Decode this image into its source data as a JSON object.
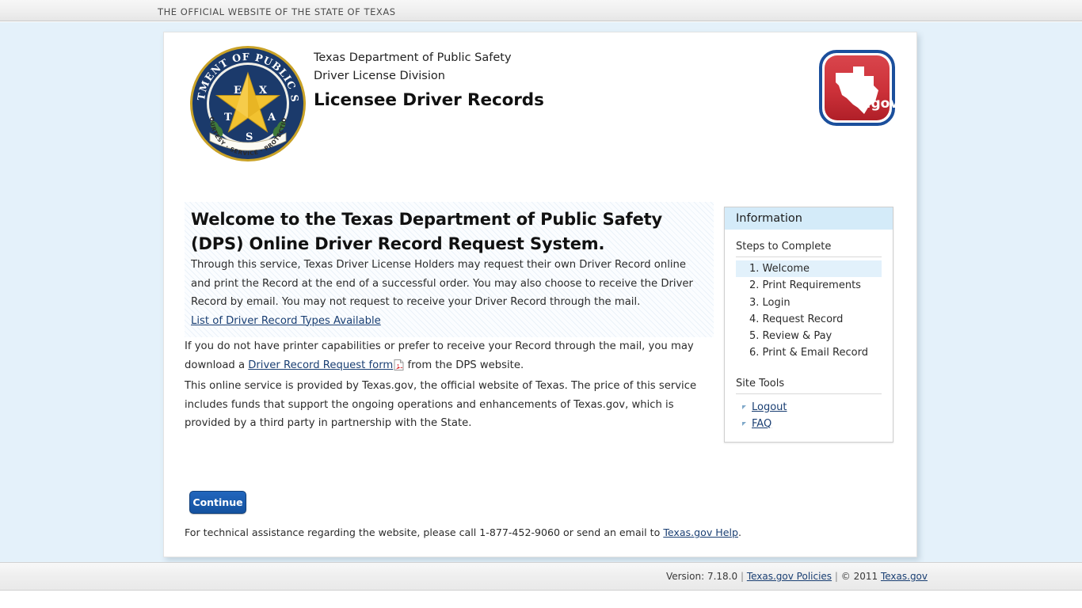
{
  "state_bar": {
    "text": "THE OFFICIAL WEBSITE OF THE STATE OF TEXAS"
  },
  "header": {
    "agency_line1": "Texas Department of Public Safety",
    "agency_line2": "Driver License Division",
    "app_title": "Licensee Driver Records",
    "seal_icon": "dps-seal-icon",
    "seal_text": {
      "arc_top": "DEPARTMENT OF PUBLIC SAFETY",
      "star_letters": [
        "T",
        "E",
        "X",
        "A",
        "S"
      ],
      "banner": "COURTESY · SERVICE · PROTECTION"
    },
    "texasgov_logo": {
      "icon": "texas-gov-logo-icon",
      "label": ".gov"
    }
  },
  "main": {
    "heading": "Welcome to the Texas Department of Public Safety (DPS) Online Driver Record Request System.",
    "paragraph_intro": "Through this service, Texas Driver License Holders may request their own Driver Record online and print the Record at the end of a successful order. You may also choose to receive the Driver Record by email. You may not request to receive your Driver Record through the mail.",
    "link_record_types": "List of Driver Record Types Available",
    "paragraph_mail_prefix": "If you do not have printer capabilities or prefer to receive your Record through the mail, you may download a ",
    "link_request_form": "Driver Record Request form",
    "pdf_icon": "pdf-file-icon",
    "paragraph_mail_suffix": " from the DPS website.",
    "paragraph_provided": "This online service is provided by Texas.gov, the official website of Texas. The price of this service includes funds that support the ongoing operations and enhancements of Texas.gov, which is provided by a third party in partnership with the State.",
    "continue_label": "Continue",
    "tech_note_prefix": "For technical assistance regarding the website, please call 1-877-452-9060 or send an email to ",
    "tech_note_link": "Texas.gov Help",
    "tech_note_suffix": "."
  },
  "sidebar": {
    "title": "Information",
    "steps_label": "Steps to Complete",
    "steps": [
      {
        "label": "1. Welcome",
        "active": true
      },
      {
        "label": "2. Print Requirements",
        "active": false
      },
      {
        "label": "3. Login",
        "active": false
      },
      {
        "label": "4. Request Record",
        "active": false
      },
      {
        "label": "5. Review & Pay",
        "active": false
      },
      {
        "label": "6. Print & Email Record",
        "active": false
      }
    ],
    "tools_label": "Site Tools",
    "tools": [
      {
        "label": "Logout"
      },
      {
        "label": "FAQ"
      }
    ]
  },
  "footer": {
    "version": "Version: 7.18.0",
    "sep1": "|",
    "policies_link": "Texas.gov Policies",
    "sep2": "|",
    "copyright": "© 2011",
    "texasgov_link": "Texas.gov"
  },
  "colors": {
    "page_background": "#e4f1fa",
    "accent_blue": "#14529f",
    "link_blue": "#1a3f73",
    "panel_header": "#d4ebf9",
    "active_step": "#e2f1fb",
    "seal_navy": "#1b3a6b",
    "seal_gold": "#f2c230",
    "texasgov_red": "#c3262e"
  }
}
